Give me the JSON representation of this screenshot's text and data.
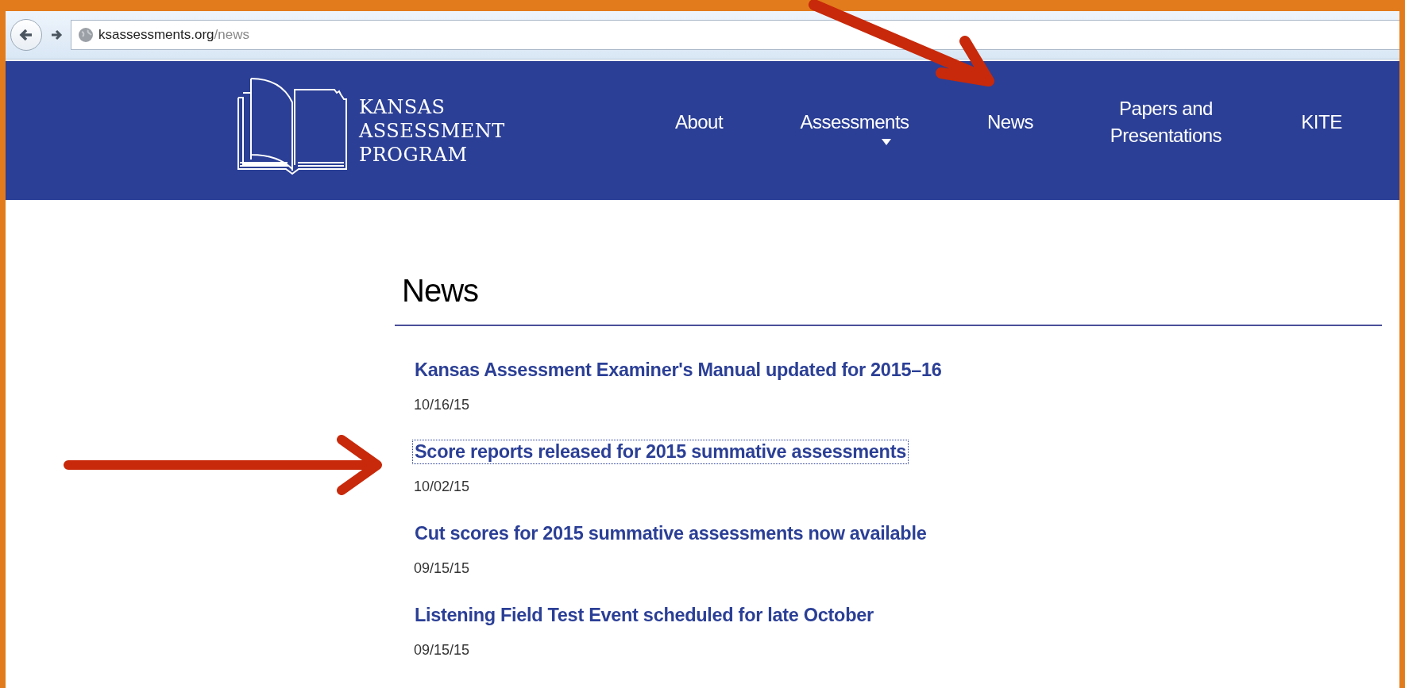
{
  "browser": {
    "url_host": "ksassessments.org",
    "url_path": "/news"
  },
  "site": {
    "logo_lines": [
      "KANSAS",
      "ASSESSMENT",
      "PROGRAM"
    ],
    "nav": [
      {
        "label": "About",
        "has_menu": false
      },
      {
        "label": "Assessments",
        "has_menu": true
      },
      {
        "label": "News",
        "has_menu": false
      },
      {
        "label": "Papers and Presentations",
        "has_menu": false
      },
      {
        "label": "KITE",
        "has_menu": false
      }
    ]
  },
  "page": {
    "heading": "News",
    "items": [
      {
        "title": "Kansas Assessment Examiner's Manual updated for 2015–16",
        "date": "10/16/15",
        "focused": false
      },
      {
        "title": "Score reports released for 2015 summative assessments",
        "date": "10/02/15",
        "focused": true
      },
      {
        "title": "Cut scores for 2015 summative assessments now available",
        "date": "09/15/15",
        "focused": false
      },
      {
        "title": "Listening Field Test Event scheduled for late October",
        "date": "09/15/15",
        "focused": false
      }
    ]
  }
}
